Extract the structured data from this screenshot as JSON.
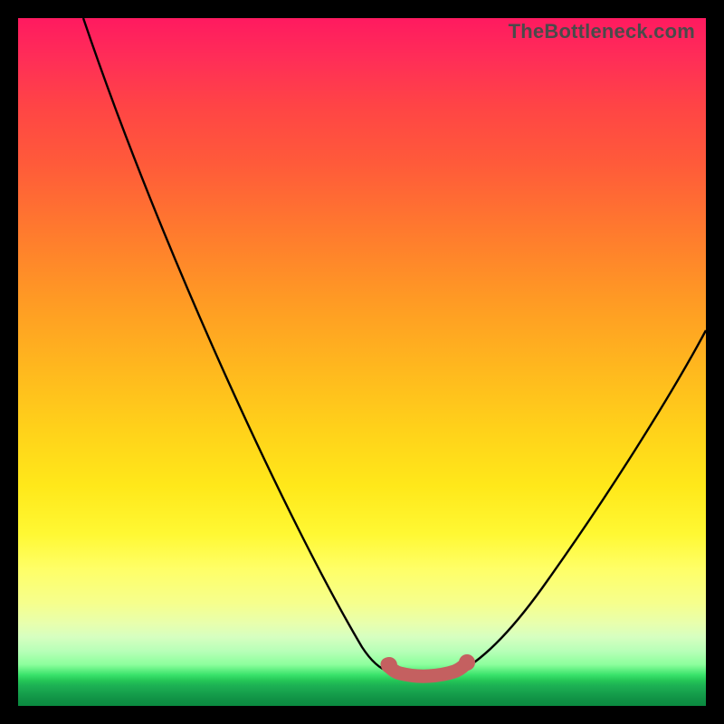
{
  "watermark": "TheBottleneck.com",
  "chart_data": {
    "type": "area",
    "title": "",
    "xlabel": "",
    "ylabel": "",
    "xlim": [
      0,
      100
    ],
    "ylim": [
      0,
      100
    ],
    "curve_left": {
      "name": "left-branch",
      "x": [
        10,
        54
      ],
      "y": [
        100,
        5
      ]
    },
    "curve_right": {
      "name": "right-branch",
      "x": [
        64,
        100
      ],
      "y": [
        5,
        55
      ]
    },
    "valley_marker": {
      "name": "valley-highlight",
      "x_range": [
        54,
        64
      ],
      "y": 5,
      "color": "#c46060"
    },
    "gradient_stops": [
      {
        "pct": 0,
        "color": "#ff1a60"
      },
      {
        "pct": 31,
        "color": "#ff7a2e"
      },
      {
        "pct": 60,
        "color": "#ffd21a"
      },
      {
        "pct": 85,
        "color": "#e8ffad"
      },
      {
        "pct": 96,
        "color": "#25c757"
      },
      {
        "pct": 100,
        "color": "#0a8a3f"
      }
    ]
  }
}
